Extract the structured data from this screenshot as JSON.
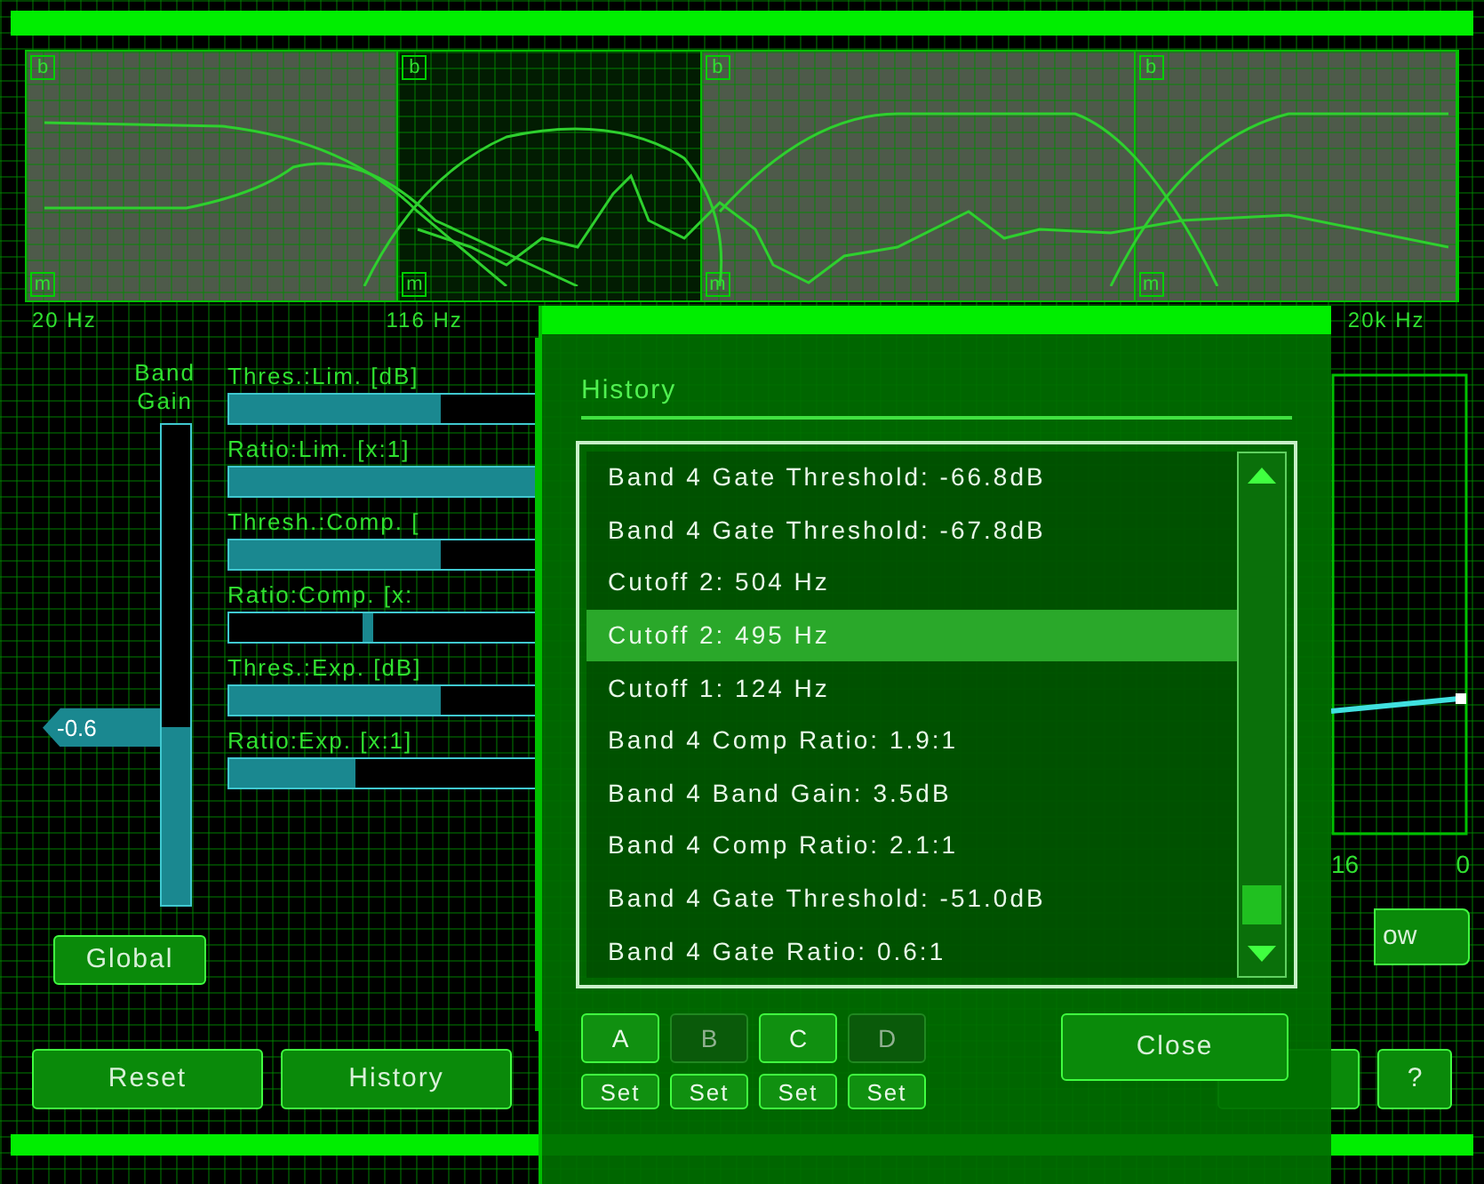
{
  "spectrum": {
    "bands": [
      {
        "top_label": "b",
        "bottom_label": "m",
        "selected": false
      },
      {
        "top_label": "b",
        "bottom_label": "m",
        "selected": true
      },
      {
        "top_label": "b",
        "bottom_label": "m",
        "selected": false
      },
      {
        "top_label": "b",
        "bottom_label": "m",
        "selected": false
      }
    ],
    "freq_labels": [
      "20 Hz",
      "116 Hz",
      "20k Hz"
    ]
  },
  "band_gain": {
    "label_line1": "Band",
    "label_line2": "Gain",
    "level": 0.37,
    "reading": "-0.6"
  },
  "sliders": [
    {
      "kind": "fill",
      "label": "Thres.:Lim. [dB]",
      "level": 0.6
    },
    {
      "kind": "fill",
      "label": "Ratio:Lim. [x:1]",
      "level": 1.0
    },
    {
      "kind": "fill",
      "label": "Thresh.:Comp. [",
      "level": 0.6
    },
    {
      "kind": "thumb",
      "label": "Ratio:Comp. [x:",
      "level": 0.38
    },
    {
      "kind": "fill",
      "label": "Thres.:Exp. [dB]",
      "level": 0.6
    },
    {
      "kind": "fill",
      "label": "Ratio:Exp. [x:1]",
      "level": 0.36
    }
  ],
  "global_button": "Global",
  "graph": {
    "axis_labels": [
      "16",
      "0"
    ],
    "button": "ow"
  },
  "bottom_buttons": [
    "Reset",
    "History"
  ],
  "help_button": "?",
  "history_dialog": {
    "title": "History",
    "items": [
      {
        "text": "Band 4 Gate Threshold: -66.8dB",
        "selected": false
      },
      {
        "text": "Band 4 Gate Threshold: -67.8dB",
        "selected": false
      },
      {
        "text": "Cutoff 2: 504 Hz",
        "selected": false
      },
      {
        "text": "Cutoff 2: 495 Hz",
        "selected": true
      },
      {
        "text": "Cutoff 1: 124 Hz",
        "selected": false
      },
      {
        "text": "Band 4 Comp Ratio: 1.9:1",
        "selected": false
      },
      {
        "text": "Band 4 Band Gain: 3.5dB",
        "selected": false
      },
      {
        "text": "Band 4 Comp Ratio: 2.1:1",
        "selected": false
      },
      {
        "text": "Band 4 Gate Threshold: -51.0dB",
        "selected": false
      },
      {
        "text": "Band 4 Gate Ratio: 0.6:1",
        "selected": false
      }
    ],
    "presets": [
      {
        "label": "A",
        "stored": true,
        "set": "Set"
      },
      {
        "label": "B",
        "stored": false,
        "set": "Set"
      },
      {
        "label": "C",
        "stored": true,
        "set": "Set"
      },
      {
        "label": "D",
        "stored": false,
        "set": "Set"
      }
    ],
    "close": "Close"
  }
}
